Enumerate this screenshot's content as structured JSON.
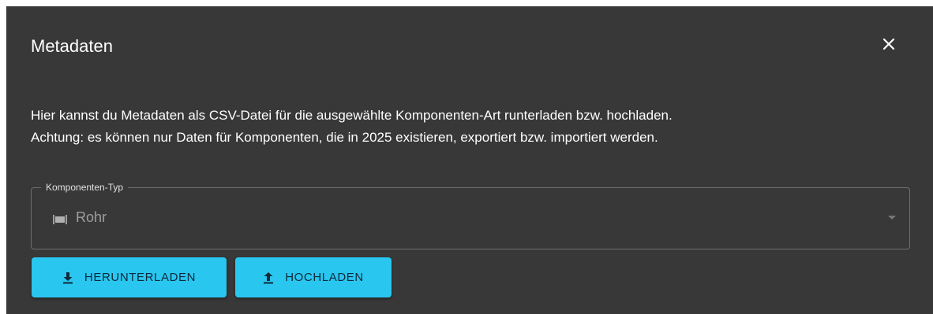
{
  "dialog": {
    "title": "Metadaten",
    "close_icon": "close-icon",
    "description_line1": "Hier kannst du Metadaten als CSV-Datei für die ausgewählte Komponenten-Art runterladen bzw. hochladen.",
    "description_line2": "Achtung: es können nur Daten für Komponenten, die in 2025 existieren, exportiert bzw. importiert werden."
  },
  "component_type_select": {
    "label": "Komponenten-Typ",
    "value": "Rohr",
    "icon": "pipe-icon",
    "open_icon": "caret-down-icon"
  },
  "actions": {
    "download_label": "HERUNTERLADEN",
    "download_icon": "download-icon",
    "upload_label": "HOCHLADEN",
    "upload_icon": "upload-icon"
  },
  "colors": {
    "dialog_background": "#383838",
    "button_accent": "#29c6f0",
    "text_primary": "#ffffff",
    "text_disabled": "#9e9e9e"
  }
}
